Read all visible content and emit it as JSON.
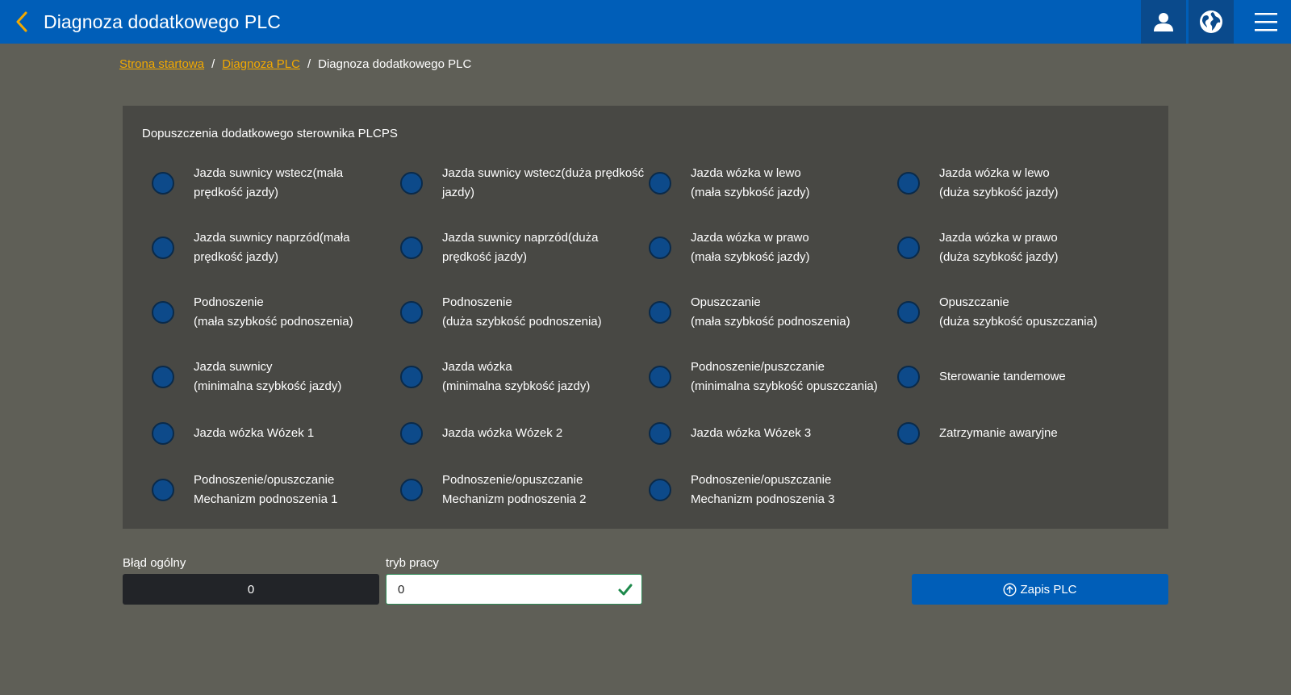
{
  "header": {
    "title": "Diagnoza dodatkowego PLC",
    "back_icon": "chevron-left-icon",
    "accent_color": "#f2a900",
    "bar_color": "#005eb8",
    "buttons": [
      "user-icon",
      "globe-icon",
      "hamburger-menu-icon"
    ]
  },
  "breadcrumb": {
    "items": [
      {
        "label": "Strona startowa",
        "link": true
      },
      {
        "label": "Diagnoza PLC",
        "link": true
      },
      {
        "label": "Diagnoza dodatkowego PLC",
        "link": false
      }
    ],
    "separator": "/"
  },
  "panel": {
    "title": "Dopuszczenia dodatkowego sterownika PLCPS",
    "lamp_color": "#0d4a8a",
    "rows": [
      [
        "Jazda suwnicy wstecz(mała\nprędkość jazdy)",
        "Jazda suwnicy wstecz(duża prędkość\njazdy)",
        "Jazda wózka w lewo\n(mała szybkość jazdy)",
        "Jazda wózka w lewo\n(duża szybkość jazdy)"
      ],
      [
        "Jazda suwnicy naprzód(mała\nprędkość jazdy)",
        "Jazda suwnicy naprzód(duża\nprędkość jazdy)",
        "Jazda wózka w prawo\n(mała szybkość jazdy)",
        "Jazda wózka w prawo\n(duża szybkość jazdy)"
      ],
      [
        "Podnoszenie\n(mała szybkość podnoszenia)",
        "Podnoszenie\n(duża szybkość podnoszenia)",
        "Opuszczanie\n(mała szybkość podnoszenia)",
        "Opuszczanie\n(duża szybkość opuszczania)"
      ],
      [
        "Jazda suwnicy\n(minimalna szybkość jazdy)",
        "Jazda wózka\n(minimalna szybkość jazdy)",
        "Podnoszenie/puszczanie\n(minimalna szybkość opuszczania)",
        "Sterowanie tandemowe"
      ],
      [
        "Jazda wózka Wózek 1",
        "Jazda wózka Wózek 2",
        "Jazda wózka Wózek 3",
        "Zatrzymanie awaryjne"
      ],
      [
        "Podnoszenie/opuszczanie\nMechanizm podnoszenia 1",
        "Podnoszenie/opuszczanie\nMechanizm podnoszenia 2",
        "Podnoszenie/opuszczanie\nMechanizm podnoszenia 3"
      ]
    ]
  },
  "form": {
    "error_label": "Błąd ogólny",
    "error_value": "0",
    "mode_label": "tryb pracy",
    "mode_value": "0",
    "mode_valid_icon": "check-icon",
    "save_label": "Zapis PLC",
    "save_icon": "upload-circle-icon"
  }
}
